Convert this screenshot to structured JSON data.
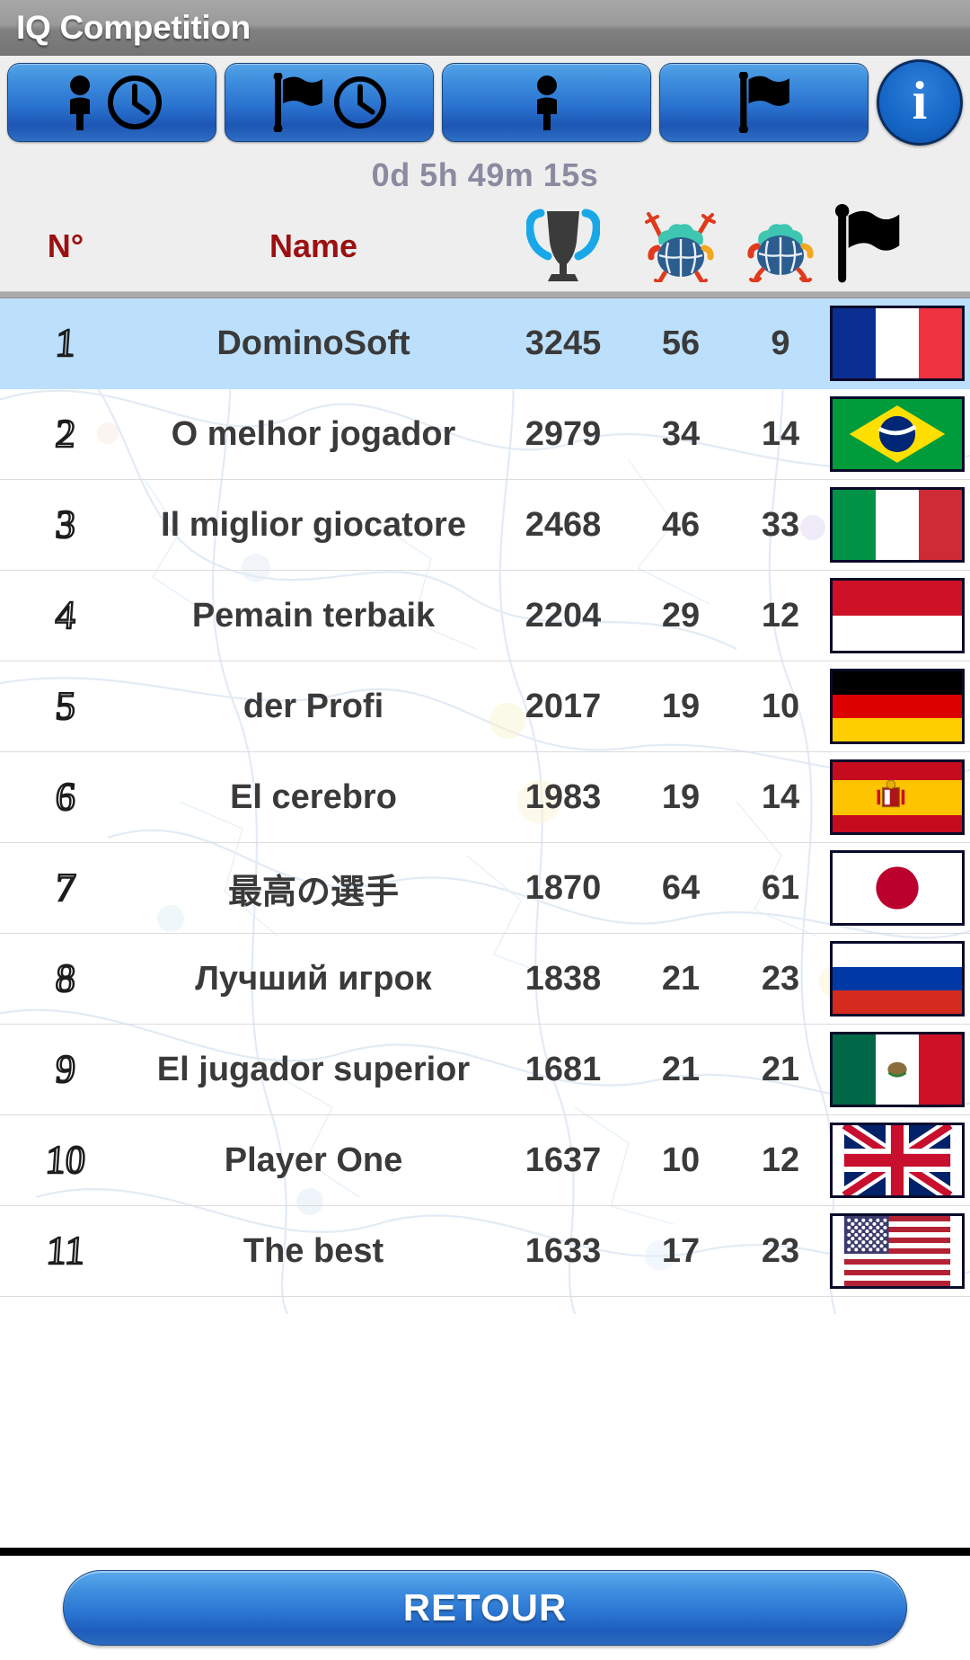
{
  "window": {
    "title": "IQ Competition"
  },
  "toolbar": {
    "buttons": [
      {
        "name": "player-time-button",
        "icons": [
          "person-icon",
          "clock-icon"
        ]
      },
      {
        "name": "flag-time-button",
        "icons": [
          "flag-icon",
          "clock-icon"
        ]
      },
      {
        "name": "player-button",
        "icons": [
          "person-icon"
        ]
      },
      {
        "name": "flag-button",
        "icons": [
          "flag-icon"
        ]
      }
    ],
    "info_button": {
      "name": "info-button",
      "glyph": "i"
    }
  },
  "timer": {
    "value": "0d 5h 49m 15s"
  },
  "table": {
    "headers": {
      "rank": "N°",
      "name": "Name",
      "score_icon": "trophy-icon",
      "wins_icon": "brain-arms-up-icon",
      "losses_icon": "brain-arms-down-icon",
      "country_icon": "flag-icon"
    },
    "header_color": "#9b1010",
    "highlight_color": "#bcdffb",
    "rows": [
      {
        "rank": "1",
        "name": "DominoSoft",
        "score": "3245",
        "a": "56",
        "b": "9",
        "country": "France",
        "flag": "fr",
        "highlight": true
      },
      {
        "rank": "2",
        "name": "O melhor jogador",
        "score": "2979",
        "a": "34",
        "b": "14",
        "country": "Brazil",
        "flag": "br",
        "highlight": false
      },
      {
        "rank": "3",
        "name": "Il miglior giocatore",
        "score": "2468",
        "a": "46",
        "b": "33",
        "country": "Italy",
        "flag": "it",
        "highlight": false
      },
      {
        "rank": "4",
        "name": "Pemain terbaik",
        "score": "2204",
        "a": "29",
        "b": "12",
        "country": "Indonesia",
        "flag": "id",
        "highlight": false
      },
      {
        "rank": "5",
        "name": "der Profi",
        "score": "2017",
        "a": "19",
        "b": "10",
        "country": "Germany",
        "flag": "de",
        "highlight": false
      },
      {
        "rank": "6",
        "name": "El cerebro",
        "score": "1983",
        "a": "19",
        "b": "14",
        "country": "Spain",
        "flag": "es",
        "highlight": false
      },
      {
        "rank": "7",
        "name": "最高の選手",
        "score": "1870",
        "a": "64",
        "b": "61",
        "country": "Japan",
        "flag": "jp",
        "highlight": false
      },
      {
        "rank": "8",
        "name": "Лучший игрок",
        "score": "1838",
        "a": "21",
        "b": "23",
        "country": "Russia",
        "flag": "ru",
        "highlight": false
      },
      {
        "rank": "9",
        "name": "El jugador superior",
        "score": "1681",
        "a": "21",
        "b": "21",
        "country": "Mexico",
        "flag": "mx",
        "highlight": false
      },
      {
        "rank": "10",
        "name": "Player One",
        "score": "1637",
        "a": "10",
        "b": "12",
        "country": "United Kingdom",
        "flag": "gb",
        "highlight": false
      },
      {
        "rank": "11",
        "name": "The best",
        "score": "1633",
        "a": "17",
        "b": "23",
        "country": "United States",
        "flag": "us",
        "highlight": false
      }
    ]
  },
  "footer": {
    "back_label": "RETOUR"
  }
}
